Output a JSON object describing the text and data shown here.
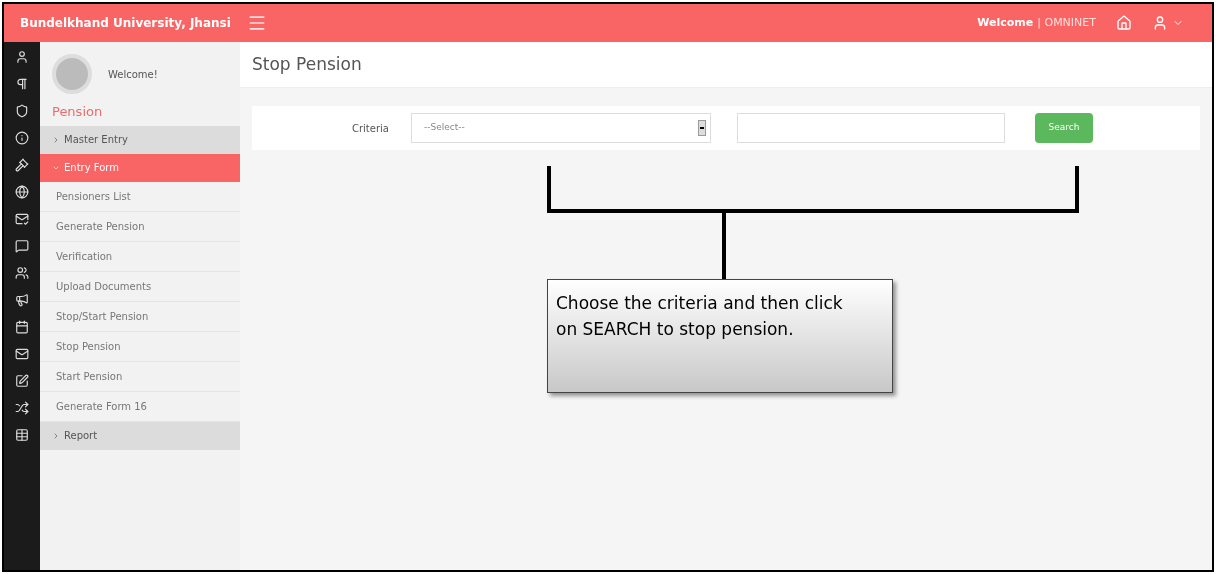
{
  "header": {
    "title": "Bundelkhand University, Jhansi",
    "welcome": "Welcome",
    "user": "| OMNINET"
  },
  "sidebar": {
    "greeting": "Welcome!",
    "section": "Pension",
    "items": [
      {
        "label": "Master Entry",
        "selected": false,
        "expanded": false
      },
      {
        "label": "Entry Form",
        "selected": true,
        "expanded": true,
        "children": [
          {
            "label": "Pensioners List",
            "selected": false
          },
          {
            "label": "Generate Pension",
            "selected": false
          },
          {
            "label": "Verification",
            "selected": false
          },
          {
            "label": "Upload Documents",
            "selected": false
          },
          {
            "label": "Stop/Start Pension",
            "selected": false
          },
          {
            "label": "Stop Pension",
            "selected": false
          },
          {
            "label": "Start Pension",
            "selected": false
          },
          {
            "label": "Generate Form 16",
            "selected": false
          }
        ]
      },
      {
        "label": "Report",
        "selected": false,
        "expanded": false
      }
    ]
  },
  "page": {
    "title": "Stop Pension",
    "criteria_label": "Criteria",
    "select_value": "--Select--",
    "search_button": "Search"
  },
  "callout": {
    "text": "Choose the criteria and then click on SEARCH to stop pension."
  }
}
